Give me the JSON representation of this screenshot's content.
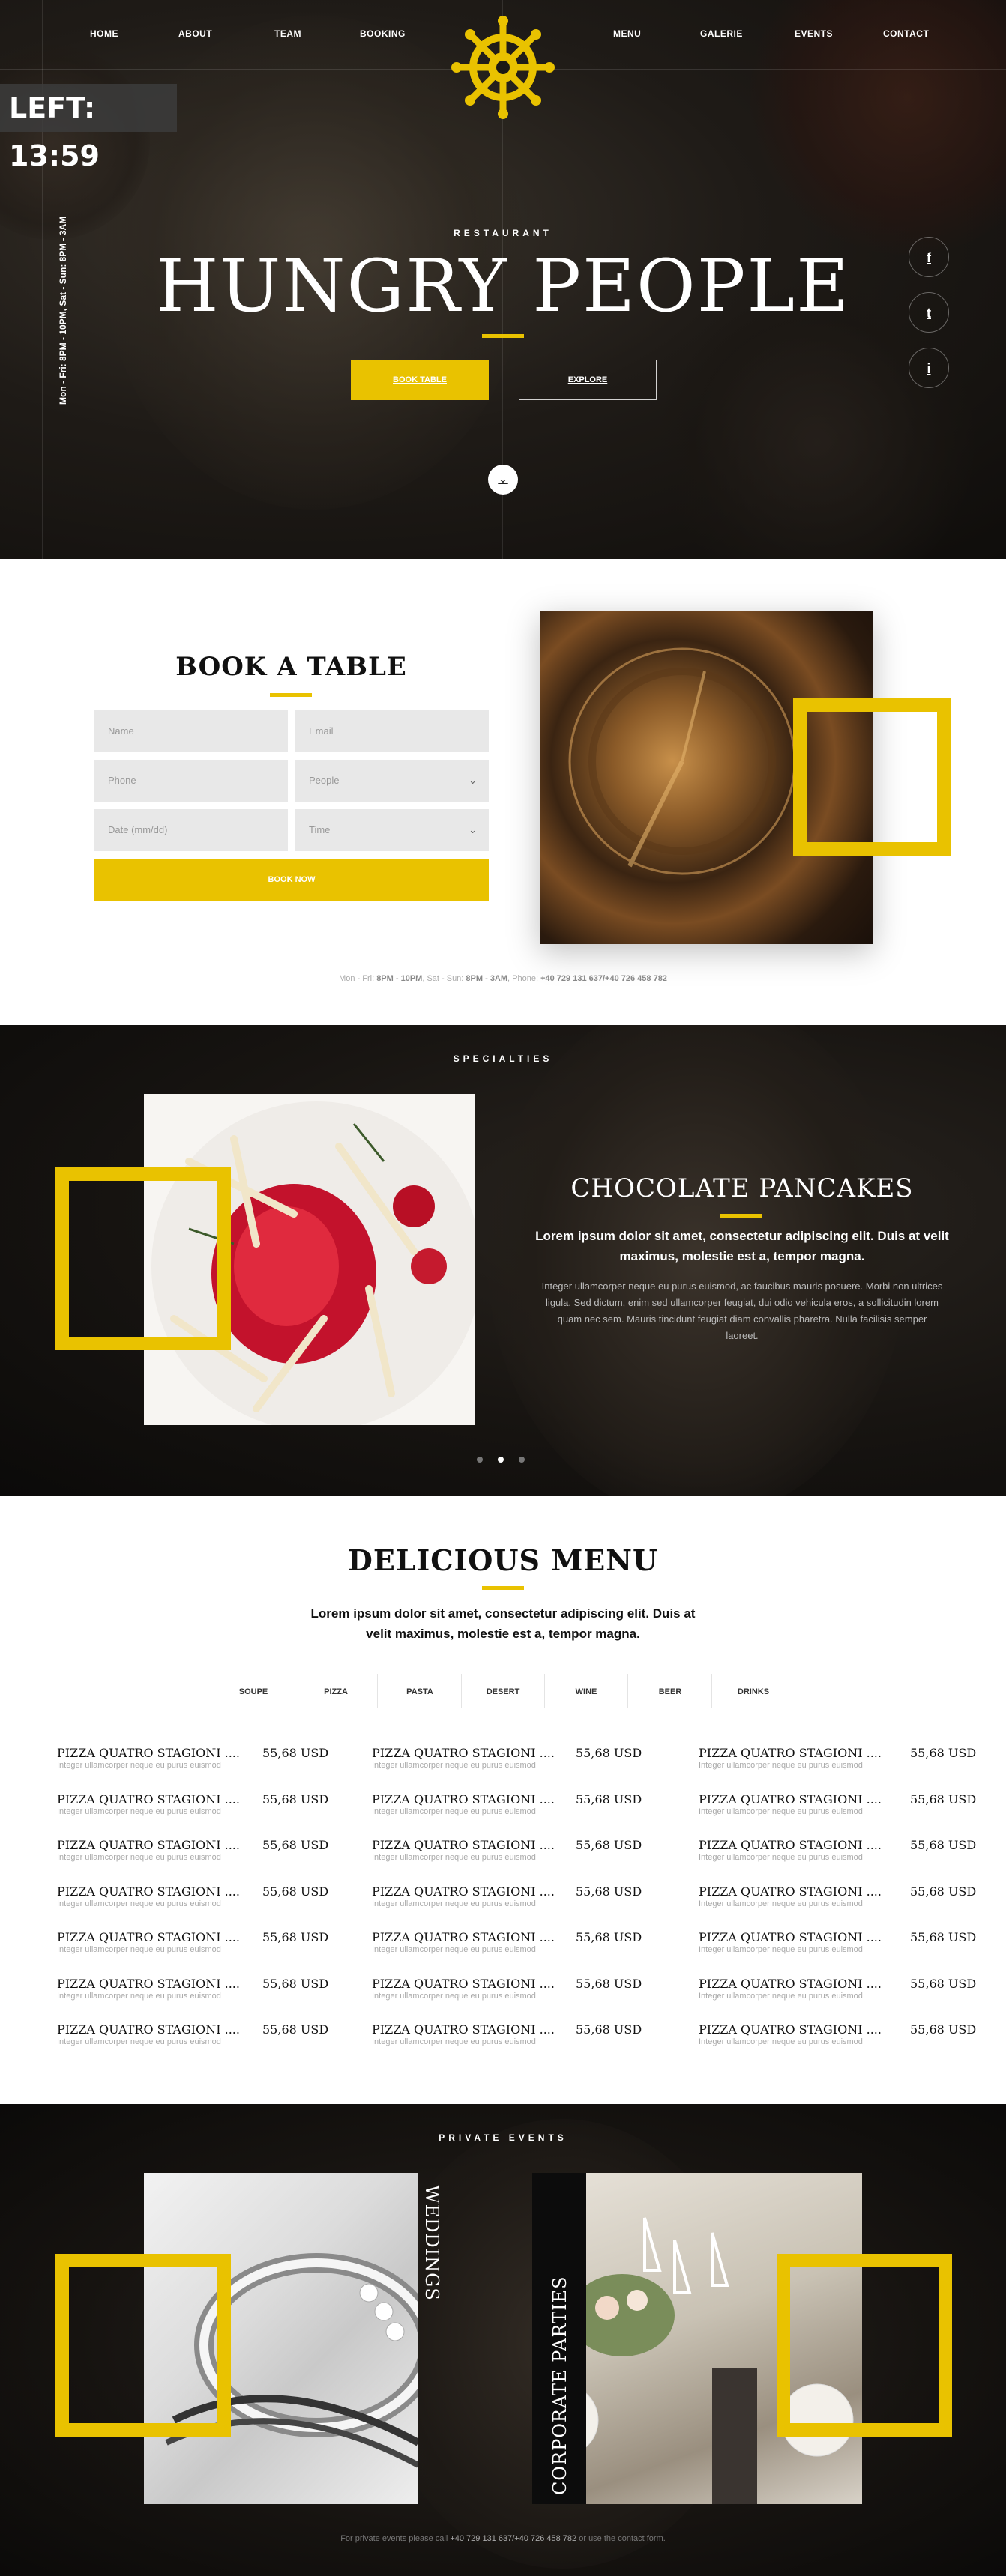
{
  "hero": {
    "nav_left": [
      "HOME",
      "ABOUT",
      "TEAM",
      "BOOKING"
    ],
    "nav_right": [
      "MENU",
      "GALERIE",
      "EVENTS",
      "CONTACT"
    ],
    "timer": "LEFT: 13:59",
    "hours": "Mon - Fri: 8PM - 10PM, Sat - Sun: 8PM - 3AM",
    "kicker": "RESTAURANT",
    "title": "HUNGRY PEOPLE",
    "book_button": "BOOK TABLE",
    "explore_button": "EXPLORE",
    "social_icons": [
      "f",
      "t",
      "i"
    ],
    "accent_color": "#e9c200"
  },
  "booking": {
    "title": "BOOK A TABLE",
    "name_placeholder": "Name",
    "email_placeholder": "Email",
    "phone_placeholder": "Phone",
    "people_placeholder": "People",
    "date_placeholder": "Date (mm/dd)",
    "time_placeholder": "Time",
    "submit": "BOOK NOW",
    "info_prefix": "Mon - Fri: ",
    "info_hours1": "8PM - 10PM",
    "info_mid": ", Sat - Sun: ",
    "info_hours2": "8PM - 3AM",
    "info_phone_label": ", Phone: ",
    "info_phone": "+40 729 131 637/+40 726 458 782"
  },
  "specialties": {
    "label": "SPECIALTIES",
    "dish_title": "CHOCOLATE PANCAKES",
    "lead": "Lorem ipsum dolor sit amet, consectetur adipiscing elit. Duis at velit maximus, molestie est a, tempor magna.",
    "body": "Integer ullamcorper neque eu purus euismod, ac faucibus mauris posuere. Morbi non ultrices ligula. Sed dictum, enim sed ullamcorper feugiat, dui odio vehicula eros, a sollicitudin lorem quam nec sem. Mauris tincidunt feugiat diam convallis pharetra. Nulla facilisis semper laoreet."
  },
  "menu": {
    "title": "DELICIOUS MENU",
    "lead": "Lorem ipsum dolor sit amet, consectetur adipiscing elit. Duis at velit maximus, molestie est a, tempor magna.",
    "tabs": [
      "SOUPE",
      "PIZZA",
      "PASTA",
      "DESERT",
      "WINE",
      "BEER",
      "DRINKS"
    ],
    "item_name": "PIZZA QUATRO STAGIONI",
    "item_dots": "....",
    "item_price": "55,68 USD",
    "item_desc": "Integer ullamcorper neque eu purus euismod",
    "columns": 3,
    "rows": 7
  },
  "events": {
    "label": "PRIVATE EVENTS",
    "weddings": "WEDDINGS",
    "corporate": "CORPORATE PARTIES",
    "footer_prefix": "For private events please call ",
    "footer_phone": "+40 729 131 637/+40 726 458 782",
    "footer_suffix": " or use the contact form."
  }
}
